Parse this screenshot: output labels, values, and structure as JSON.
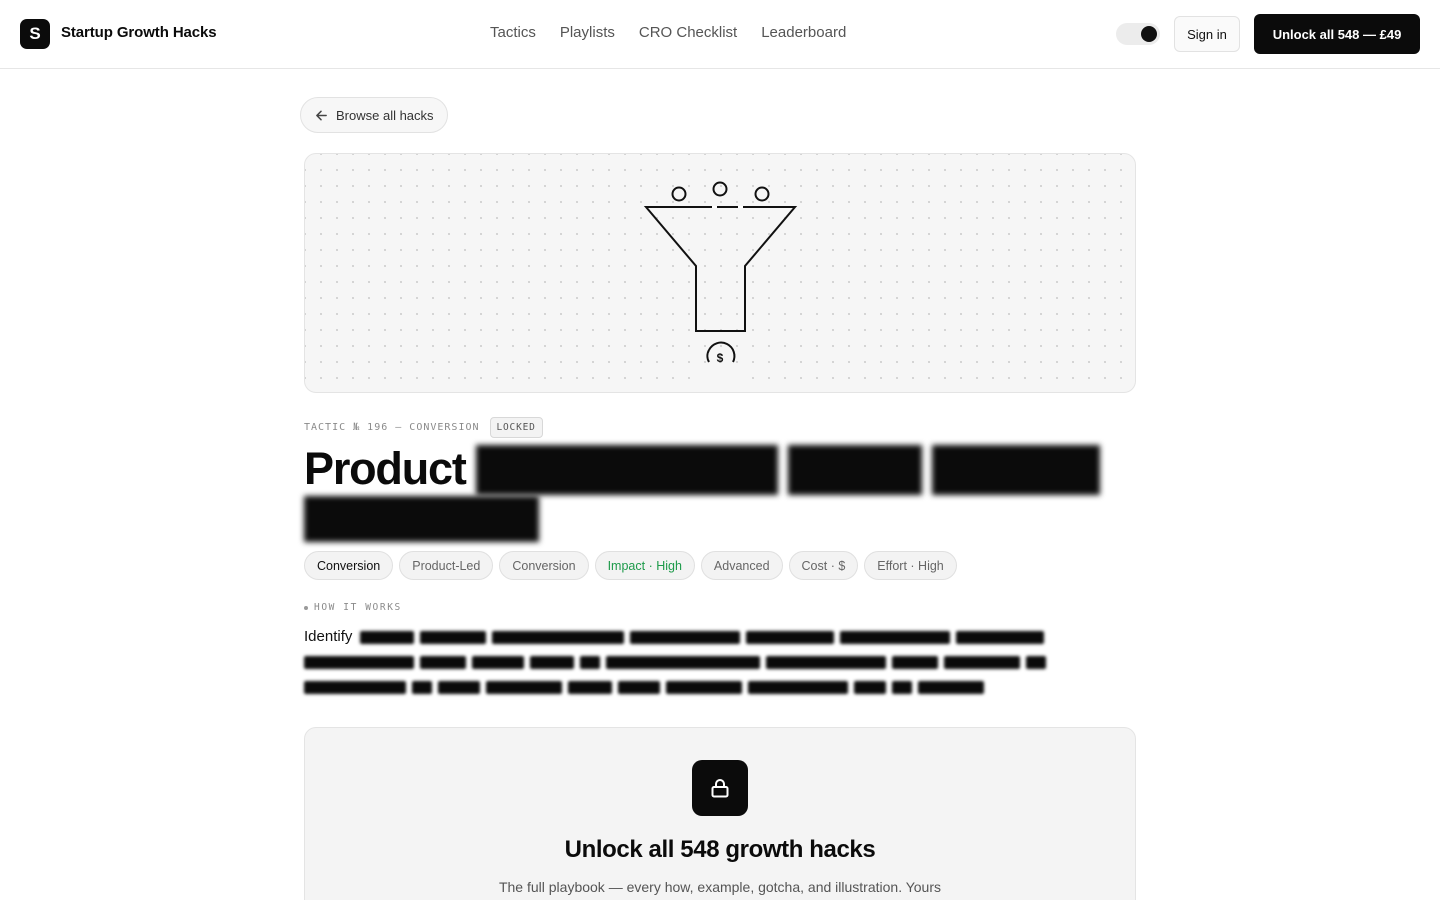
{
  "header": {
    "logo_letter": "S",
    "brand": "Startup Growth Hacks",
    "nav": [
      "Tactics",
      "Playlists",
      "CRO Checklist",
      "Leaderboard"
    ],
    "theme_toggle_icon": "toggle-switch",
    "signin_label": "Sign in",
    "unlock_label": "Unlock all 548 — £49"
  },
  "back": {
    "label": "Browse all hacks",
    "icon": "arrow-left-icon"
  },
  "illustration": {
    "icon": "funnel-icon",
    "coin_symbol": "$"
  },
  "tactic": {
    "meta": "TACTIC № 196 — CONVERSION",
    "badge": "LOCKED",
    "title_visible": "Product"
  },
  "tags": [
    {
      "label": "Conversion",
      "style": "primary"
    },
    {
      "label": "Product-Led",
      "style": "default"
    },
    {
      "label": "Conversion",
      "style": "default"
    },
    {
      "label": "Impact · High",
      "style": "green"
    },
    {
      "label": "Advanced",
      "style": "default"
    },
    {
      "label": "Cost · $",
      "style": "default"
    },
    {
      "label": "Effort · High",
      "style": "default"
    }
  ],
  "how": {
    "label": "HOW IT WORKS",
    "first_word": "Identify"
  },
  "unlock_card": {
    "icon": "lock-icon",
    "title": "Unlock all 548 growth hacks",
    "subtitle": "The full playbook — every how, example, gotcha, and illustration. Yours"
  },
  "colors": {
    "accent": "#0b0b0b",
    "impact_green": "#1d9a4a",
    "card_bg": "#f4f4f4"
  }
}
